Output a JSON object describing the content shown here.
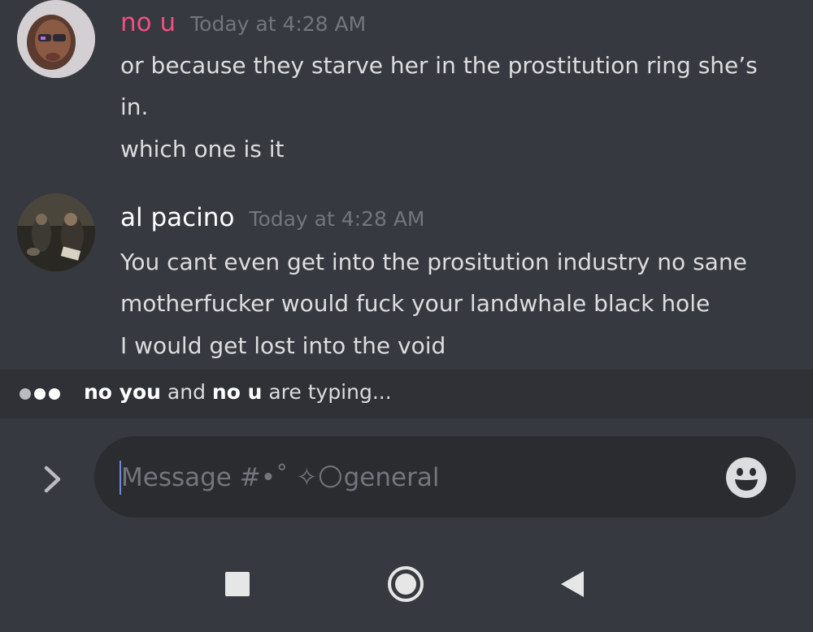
{
  "messages": [
    {
      "username": "no u",
      "timestamp": "Today at 4:28 AM",
      "lines": [
        "or because they starve her in the prostitution ring she’s",
        "in.",
        "which one is it"
      ],
      "name_color": "#f04f7e"
    },
    {
      "username": "al pacino",
      "timestamp": "Today at 4:28 AM",
      "lines": [
        "You cant even get into the prositution industry no sane",
        "motherfucker would fuck your landwhale black hole",
        "I would get lost into the void"
      ],
      "name_color": "#ffffff"
    }
  ],
  "typing": {
    "user1": "no you",
    "conj": "and",
    "user2": "no u",
    "suffix": "are typing..."
  },
  "composer": {
    "placeholder": "Message #•˚ ✧🌕general",
    "expand_icon": "chevron-right-icon",
    "emoji_icon": "smiley-icon"
  },
  "navbar": {
    "icons": [
      "recents-icon",
      "home-icon",
      "back-icon"
    ]
  },
  "colors": {
    "background": "#36393f",
    "typing_bar": "#2f3136",
    "input": "#2a2c30",
    "accent": "#7289da"
  }
}
